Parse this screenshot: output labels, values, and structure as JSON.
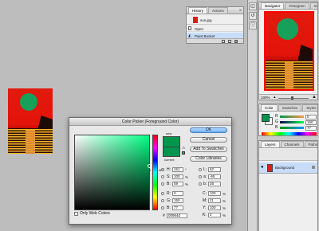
{
  "history": {
    "tabs": [
      "History",
      "Actions"
    ],
    "snapshot": "sun.jpg",
    "items": [
      "Open",
      "Paint Bucket"
    ]
  },
  "navigator": {
    "tabs": [
      "Navigator",
      "Histogram",
      "Info"
    ],
    "zoom": "100%"
  },
  "color_panel": {
    "tabs": [
      "Color",
      "Swatches",
      "Styles"
    ],
    "sliders": [
      {
        "label": "R",
        "value": "0"
      },
      {
        "label": "G",
        "value": "150"
      },
      {
        "label": "B",
        "value": "77"
      }
    ]
  },
  "layers": {
    "tabs": [
      "Layers",
      "Channels",
      "Paths"
    ],
    "layer_name": "Background"
  },
  "picker": {
    "title": "Color Picker (Foreground Color)",
    "buttons": {
      "ok": "OK",
      "cancel": "Cancel",
      "swatches": "Add To Swatches",
      "libraries": "Color Libraries"
    },
    "label_new": "new",
    "label_current": "current",
    "hsb": [
      {
        "label": "H:",
        "value": "151",
        "unit": "°"
      },
      {
        "label": "S:",
        "value": "100",
        "unit": "%"
      },
      {
        "label": "B:",
        "value": "59",
        "unit": "%"
      }
    ],
    "rgb": [
      {
        "label": "R:",
        "value": "0"
      },
      {
        "label": "G:",
        "value": "150"
      },
      {
        "label": "B:",
        "value": "77"
      }
    ],
    "lab": [
      {
        "label": "L:",
        "value": "52"
      },
      {
        "label": "a:",
        "value": "-65"
      },
      {
        "label": "b:",
        "value": "26"
      }
    ],
    "cmyk": [
      {
        "label": "C:",
        "value": "100",
        "unit": "%"
      },
      {
        "label": "M:",
        "value": "11",
        "unit": "%"
      },
      {
        "label": "Y:",
        "value": "100",
        "unit": "%"
      },
      {
        "label": "K:",
        "value": "2",
        "unit": "%"
      }
    ],
    "hex_label": "#",
    "hex": "00964d",
    "web_only": "Only Web Colors"
  },
  "colors": {
    "foreground": "#00964d",
    "background": "#ffffff",
    "selection": "#c7dcf8"
  }
}
